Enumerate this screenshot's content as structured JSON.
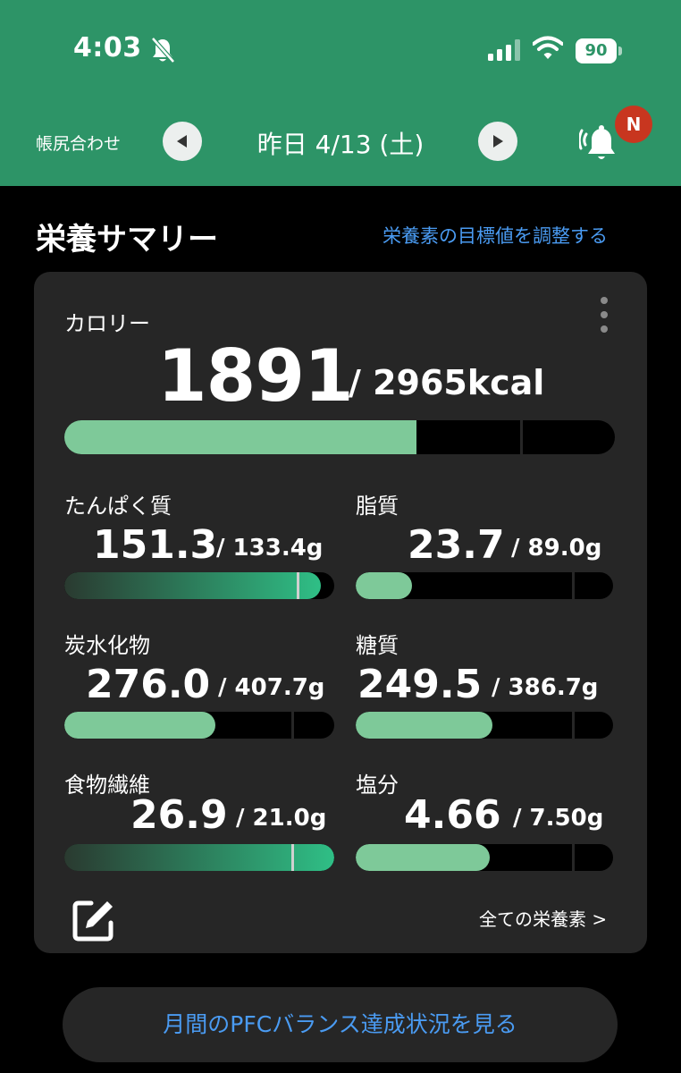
{
  "status_bar": {
    "time": "4:03",
    "battery": "90"
  },
  "nav": {
    "reconcile_label": "帳尻合わせ",
    "date": "昨日 4/13 (土)",
    "notification_badge": "N"
  },
  "summary": {
    "title": "栄養サマリー",
    "adjust_link": "栄養素の目標値を調整する"
  },
  "calorie": {
    "label": "カロリー",
    "value": "1891",
    "target": "/ 2965kcal",
    "progress": 0.64
  },
  "nutrients": [
    {
      "label": "たんぱく質",
      "value": "151.3",
      "target": "/ 133.4g",
      "progress": 0.95,
      "target_mark": 0.86,
      "style": "grad"
    },
    {
      "label": "脂質",
      "value": "23.7",
      "target": "/ 89.0g",
      "progress": 0.22,
      "target_mark": 0.84,
      "style": "solid"
    },
    {
      "label": "炭水化物",
      "value": "276.0",
      "target": "/ 407.7g",
      "progress": 0.56,
      "target_mark": 0.84,
      "style": "solid"
    },
    {
      "label": "糖質",
      "value": "249.5",
      "target": "/ 386.7g",
      "progress": 0.53,
      "target_mark": 0.84,
      "style": "solid"
    },
    {
      "label": "食物繊維",
      "value": "26.9",
      "target": "/ 21.0g",
      "progress": 1.0,
      "target_mark": 0.84,
      "style": "grad"
    },
    {
      "label": "塩分",
      "value": "4.66",
      "target": "/ 7.50g",
      "progress": 0.52,
      "target_mark": 0.84,
      "style": "solid"
    }
  ],
  "footer": {
    "all_nutrients": "全ての栄養素 >",
    "pfc_button": "月間のPFCバランス達成状況を見る"
  },
  "colors": {
    "header": "#2d9467",
    "card": "#262626",
    "accent_link": "#4a9bf2",
    "bar_fill": "#7ec999",
    "badge": "#c8361f"
  }
}
